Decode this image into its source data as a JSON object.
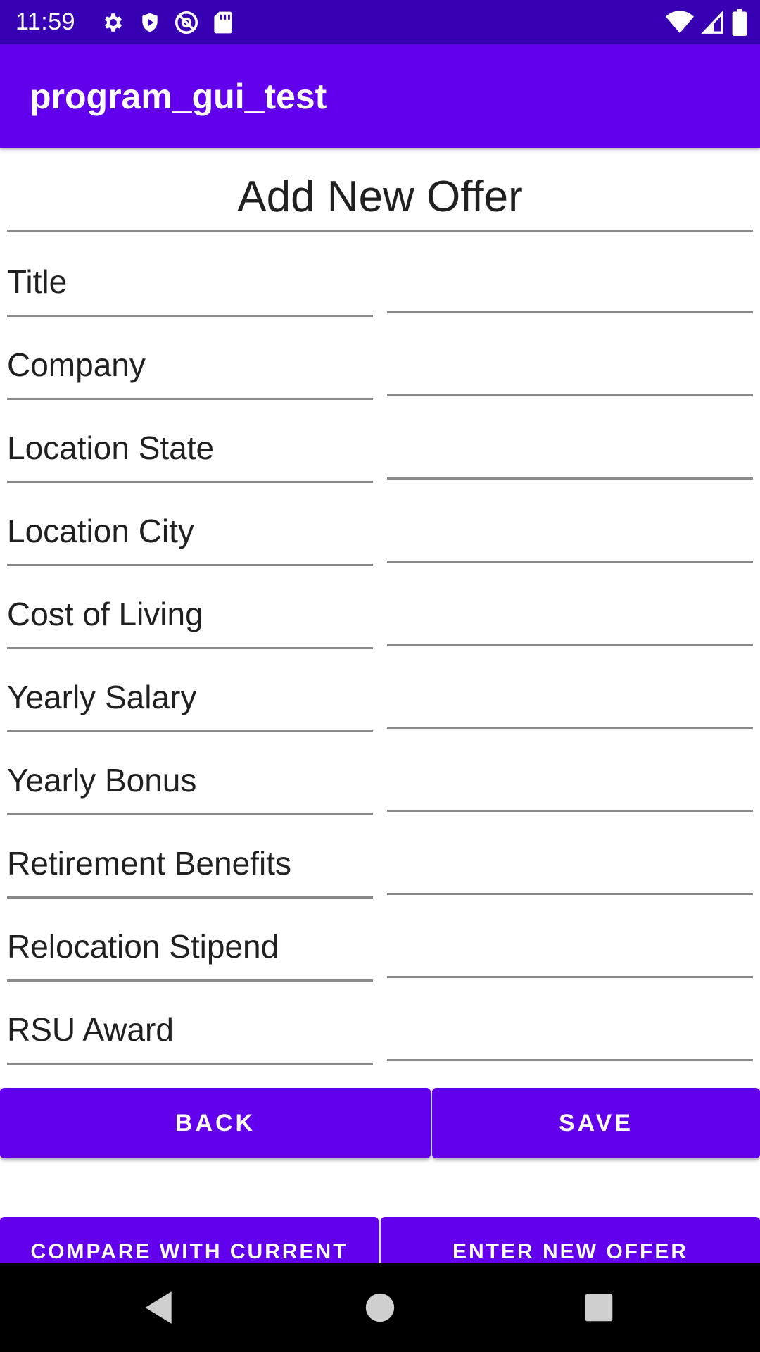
{
  "status_bar": {
    "time": "11:59",
    "left_icons": [
      "gear-icon",
      "shield-icon",
      "at-sign-icon",
      "sd-card-icon"
    ],
    "right_icons": [
      "wifi-icon",
      "cellular-signal-icon",
      "battery-icon"
    ]
  },
  "app_bar": {
    "title": "program_gui_test",
    "color": "#6200ee"
  },
  "form": {
    "heading": "Add New Offer",
    "fields": [
      {
        "label": "Title",
        "value": ""
      },
      {
        "label": "Company",
        "value": ""
      },
      {
        "label": "Location State",
        "value": ""
      },
      {
        "label": "Location City",
        "value": ""
      },
      {
        "label": "Cost of Living",
        "value": ""
      },
      {
        "label": "Yearly Salary",
        "value": ""
      },
      {
        "label": "Yearly Bonus",
        "value": ""
      },
      {
        "label": "Retirement Benefits",
        "value": ""
      },
      {
        "label": "Relocation Stipend",
        "value": ""
      },
      {
        "label": "RSU Award",
        "value": ""
      }
    ]
  },
  "buttons": {
    "back": "BACK",
    "save": "SAVE",
    "compare": "COMPARE WITH CURRENT",
    "enter_new": "ENTER NEW OFFER"
  },
  "nav_bar": {
    "icons": [
      "back-triangle-icon",
      "home-circle-icon",
      "recents-square-icon"
    ]
  },
  "colors": {
    "status_bar": "#3700b3",
    "primary": "#6200ee",
    "nav_bar": "#000000"
  }
}
